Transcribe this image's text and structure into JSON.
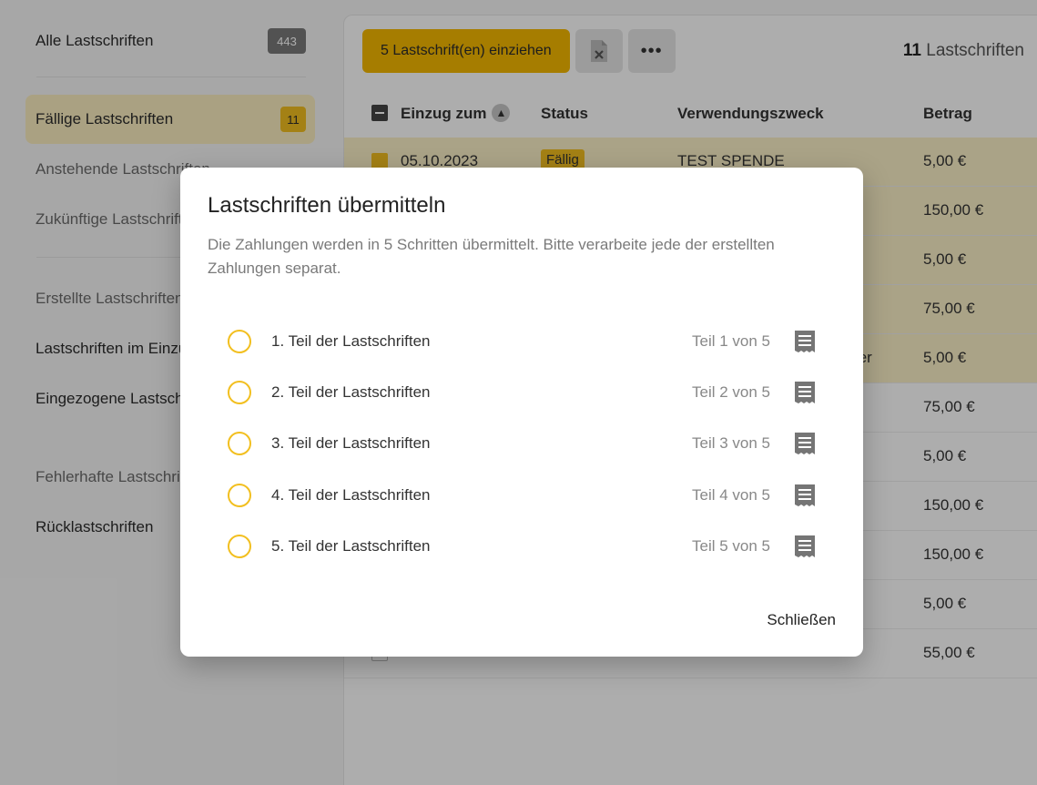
{
  "sidebar": {
    "items": [
      {
        "label": "Alle Lastschriften",
        "badge": "443"
      },
      {
        "label": "Fällige Lastschriften",
        "badge": "11"
      },
      {
        "label": "Anstehende Lastschriften"
      },
      {
        "label": "Zukünftige Lastschriften"
      },
      {
        "label": "Erstellte Lastschriften"
      },
      {
        "label": "Lastschriften im Einzug"
      },
      {
        "label": "Eingezogene Lastschriften"
      },
      {
        "label": "Fehlerhafte Lastschriften"
      },
      {
        "label": "Rücklastschriften"
      }
    ]
  },
  "toolbar": {
    "collect_label": "5 Lastschrift(en) einziehen",
    "more_label": "•••",
    "count_number": "11",
    "count_text": "Lastschriften"
  },
  "table": {
    "headers": {
      "date": "Einzug zum",
      "status": "Status",
      "purpose": "Verwendungszweck",
      "amount": "Betrag"
    },
    "rows": [
      {
        "date": "05.10.2023",
        "status": "Fällig",
        "purpose": "TEST SPENDE",
        "amount": "5,00 €"
      },
      {
        "date": "",
        "status": "",
        "purpose": "",
        "amount": "150,00 €"
      },
      {
        "date": "",
        "status": "",
        "purpose": "",
        "amount": "5,00 €"
      },
      {
        "date": "",
        "status": "",
        "purpose": "",
        "amount": "75,00 €"
      },
      {
        "date": "",
        "status": "",
        "purpose": "ter",
        "amount": "5,00 €"
      },
      {
        "date": "",
        "status": "",
        "purpose": "",
        "amount": "75,00 €"
      },
      {
        "date": "",
        "status": "",
        "purpose": "",
        "amount": "5,00 €"
      },
      {
        "date": "",
        "status": "",
        "purpose": "",
        "amount": "150,00 €"
      },
      {
        "date": "",
        "status": "",
        "purpose": "",
        "amount": "150,00 €"
      },
      {
        "date": "",
        "status": "",
        "purpose": "",
        "amount": "5,00 €"
      },
      {
        "date": "",
        "status": "",
        "purpose": "",
        "amount": "55,00 €"
      }
    ]
  },
  "modal": {
    "title": "Lastschriften übermitteln",
    "description": "Die Zahlungen werden in 5 Schritten übermittelt. Bitte verarbeite jede der erstellten Zahlungen separat.",
    "steps": [
      {
        "label": "1. Teil der Lastschriften",
        "part": "Teil 1 von 5"
      },
      {
        "label": "2. Teil der Lastschriften",
        "part": "Teil 2 von 5"
      },
      {
        "label": "3. Teil der Lastschriften",
        "part": "Teil 3 von 5"
      },
      {
        "label": "4. Teil der Lastschriften",
        "part": "Teil 4 von 5"
      },
      {
        "label": "5. Teil der Lastschriften",
        "part": "Teil 5 von 5"
      }
    ],
    "close_label": "Schließen"
  },
  "colors": {
    "accent": "#f5b800",
    "highlight_row": "#fbf0c8",
    "active_sidebar": "#fbeec0"
  }
}
